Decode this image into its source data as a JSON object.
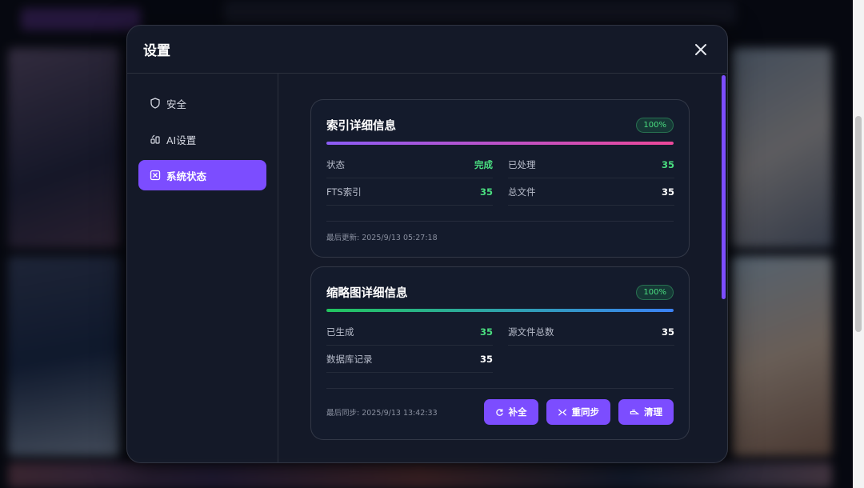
{
  "dialog": {
    "title": "设置"
  },
  "sidebar": {
    "items": [
      {
        "label": "安全",
        "icon": "shield-icon"
      },
      {
        "label": "AI设置",
        "icon": "ai-icon"
      },
      {
        "label": "系统状态",
        "icon": "status-icon",
        "active": true
      }
    ]
  },
  "index_card": {
    "title": "索引详细信息",
    "badge": "100%",
    "progress": 1.0,
    "stats": [
      {
        "label": "状态",
        "value": "完成"
      },
      {
        "label": "已处理",
        "value": "35"
      },
      {
        "label": "FTS索引",
        "value": "35"
      },
      {
        "label": "总文件",
        "value": "35"
      }
    ],
    "footer": "最后更新: 2025/9/13 05:27:18"
  },
  "thumb_card": {
    "title": "缩略图详细信息",
    "badge": "100%",
    "progress": 1.0,
    "stats": [
      {
        "label": "已生成",
        "value": "35"
      },
      {
        "label": "源文件总数",
        "value": "35"
      },
      {
        "label": "数据库记录",
        "value": "35"
      }
    ],
    "footer": "最后同步: 2025/9/13 13:42:33",
    "buttons": [
      {
        "label": "补全",
        "icon": "refresh-icon"
      },
      {
        "label": "重同步",
        "icon": "shuffle-icon"
      },
      {
        "label": "清理",
        "icon": "broom-icon"
      }
    ]
  },
  "colors": {
    "accent": "#7c4dff",
    "success": "#4ade80"
  }
}
